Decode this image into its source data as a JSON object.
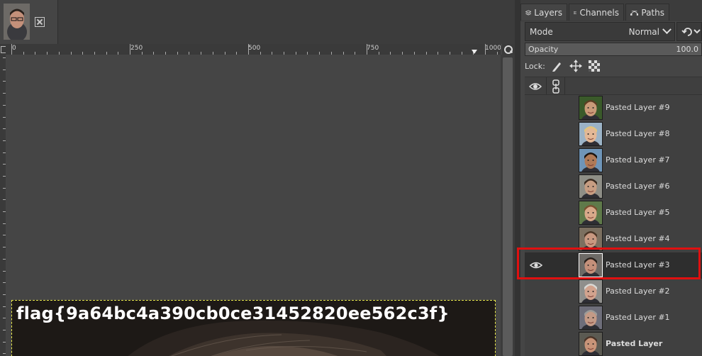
{
  "image_tab": {
    "thumb_icon": "portrait-thumbnail",
    "close_icon": "close-box-icon"
  },
  "rulers": {
    "top_labels": [
      "0",
      "250",
      "500",
      "750",
      "1000"
    ]
  },
  "canvas": {
    "overlay_text": "flag{9a64bc4a390cb0ce31452820ee562c3f}"
  },
  "dock": {
    "tabs": [
      {
        "label": "Layers",
        "icon": "layers-icon"
      },
      {
        "label": "Channels",
        "icon": "channels-icon"
      },
      {
        "label": "Paths",
        "icon": "paths-icon"
      }
    ],
    "mode_label": "Mode",
    "mode_value": "Normal",
    "opacity_label": "Opacity",
    "opacity_value": "100.0",
    "lock_label": "Lock:"
  },
  "layers": [
    {
      "name": "Pasted Layer #9",
      "visible": false,
      "selected": false,
      "bold": false,
      "skin": "#c99a78",
      "hair": "#5b3e23",
      "bg": "#3a5a2a"
    },
    {
      "name": "Pasted Layer #8",
      "visible": false,
      "selected": false,
      "bold": false,
      "skin": "#e3b896",
      "hair": "#e2c47c",
      "bg": "#9bb3c6"
    },
    {
      "name": "Pasted Layer #7",
      "visible": false,
      "selected": false,
      "bold": false,
      "skin": "#b07a57",
      "hair": "#1c140f",
      "bg": "#6f95b8"
    },
    {
      "name": "Pasted Layer #6",
      "visible": false,
      "selected": false,
      "bold": false,
      "skin": "#c79d82",
      "hair": "#3a2b20",
      "bg": "#8e8e86"
    },
    {
      "name": "Pasted Layer #5",
      "visible": false,
      "selected": false,
      "bold": false,
      "skin": "#d8a98a",
      "hair": "#7a5030",
      "bg": "#5f7a4a"
    },
    {
      "name": "Pasted Layer #4",
      "visible": false,
      "selected": false,
      "bold": false,
      "skin": "#c89880",
      "hair": "#4a3526",
      "bg": "#7c7060"
    },
    {
      "name": "Pasted Layer #3",
      "visible": true,
      "selected": true,
      "bold": false,
      "skin": "#c4907a",
      "hair": "#2a211c",
      "bg": "#6d6a66"
    },
    {
      "name": "Pasted Layer #2",
      "visible": false,
      "selected": false,
      "bold": false,
      "skin": "#d2a38e",
      "hair": "#d8d8d4",
      "bg": "#8f8f8c"
    },
    {
      "name": "Pasted Layer #1",
      "visible": false,
      "selected": false,
      "bold": false,
      "skin": "#c49a86",
      "hair": "#9b9b98",
      "bg": "#6e6e7a"
    },
    {
      "name": "Pasted Layer",
      "visible": false,
      "selected": false,
      "bold": true,
      "skin": "#c89478",
      "hair": "#4a3428",
      "bg": "#5b5a52"
    }
  ],
  "highlight_color": "#e01010"
}
